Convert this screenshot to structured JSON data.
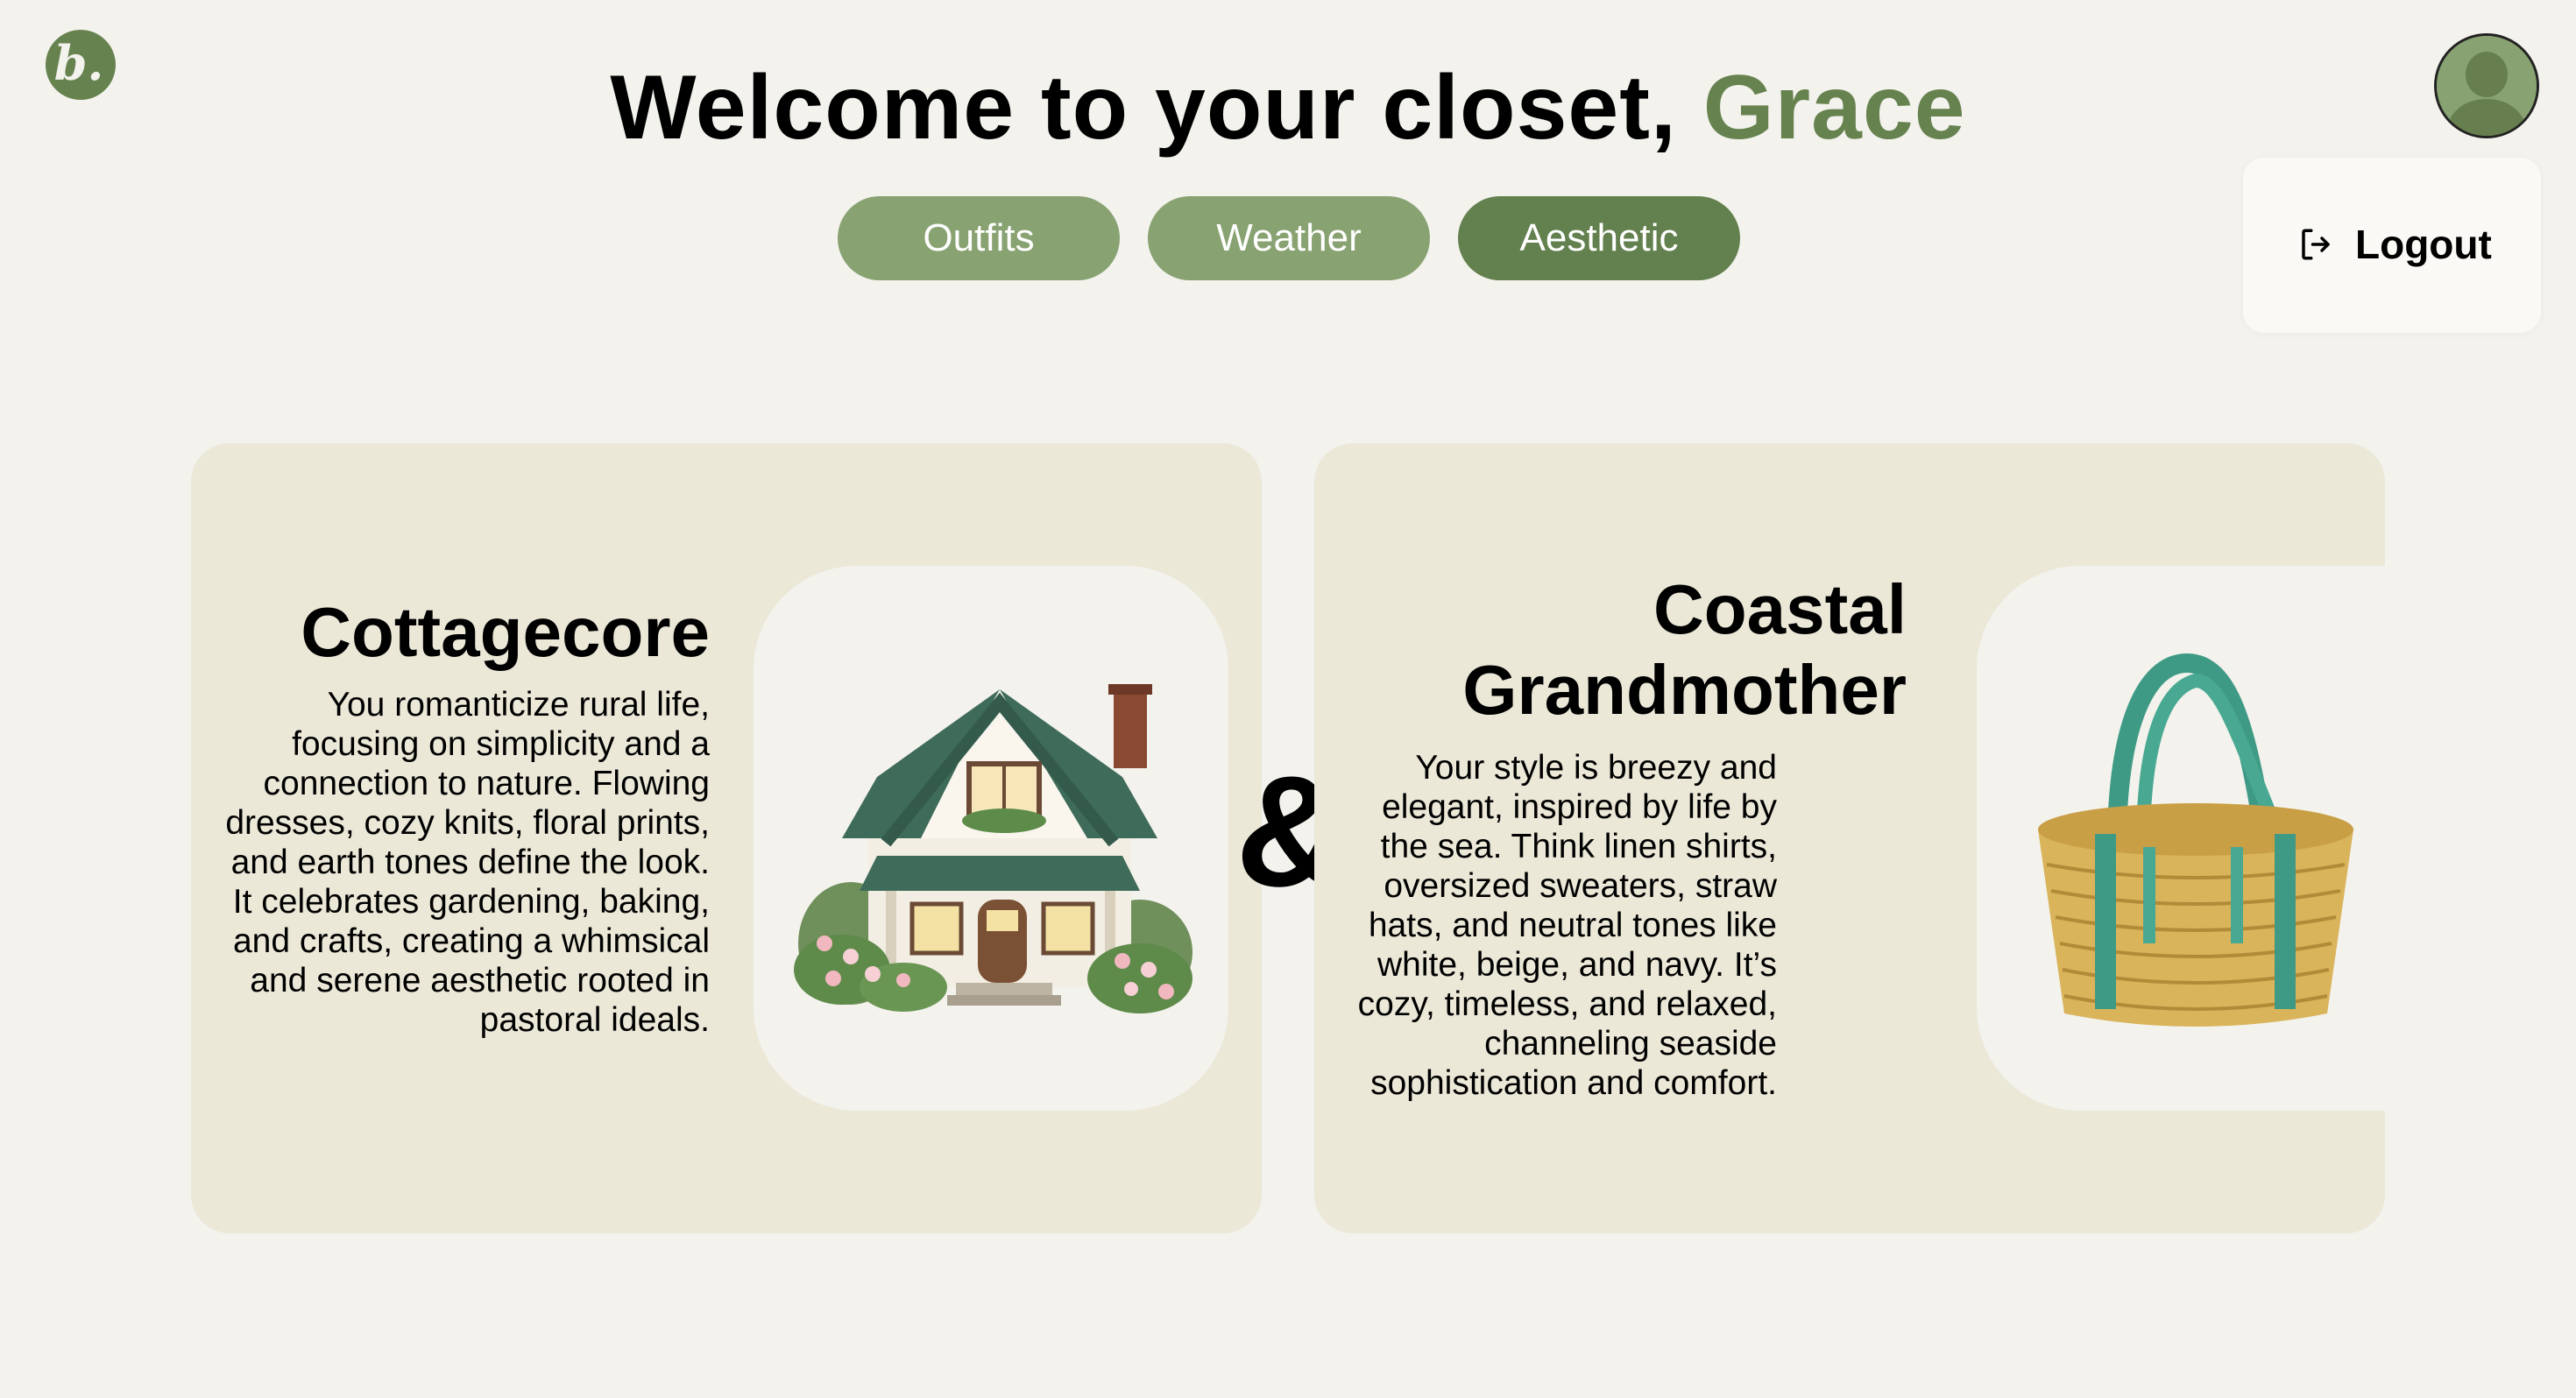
{
  "brand": {
    "logo_text": "b."
  },
  "header": {
    "welcome_text": "Welcome to your closet, ",
    "user_name": "Grace"
  },
  "tabs": [
    {
      "label": "Outfits",
      "active": false
    },
    {
      "label": "Weather",
      "active": false
    },
    {
      "label": "Aesthetic",
      "active": true
    }
  ],
  "user_menu": {
    "avatar_icon": "user-avatar-icon",
    "logout_label": "Logout",
    "logout_icon": "logout-icon"
  },
  "cards": [
    {
      "title": "Cottagecore",
      "description": "You romanticize rural life, focusing on simplicity and a connection to nature. Flowing dresses, cozy knits, floral prints, and earth tones define the look. It celebrates gardening, baking, and crafts, creating a whimsical and serene aesthetic rooted in pastoral ideals.",
      "image_icon": "cottage-house-icon"
    },
    {
      "title": "Coastal Grandmother",
      "description": "Your style is breezy and elegant, inspired by life by the sea. Think linen shirts, oversized sweaters, straw hats, and neutral tones like white, beige, and navy. It’s cozy, timeless, and relaxed, channeling seaside sophistication and comfort.",
      "image_icon": "straw-basket-icon"
    }
  ],
  "connector": "&",
  "colors": {
    "background": "#f3f2ed",
    "accent": "#66824f",
    "tab": "#88a272",
    "tab_active": "#63804f",
    "card": "#ebe8d8"
  }
}
